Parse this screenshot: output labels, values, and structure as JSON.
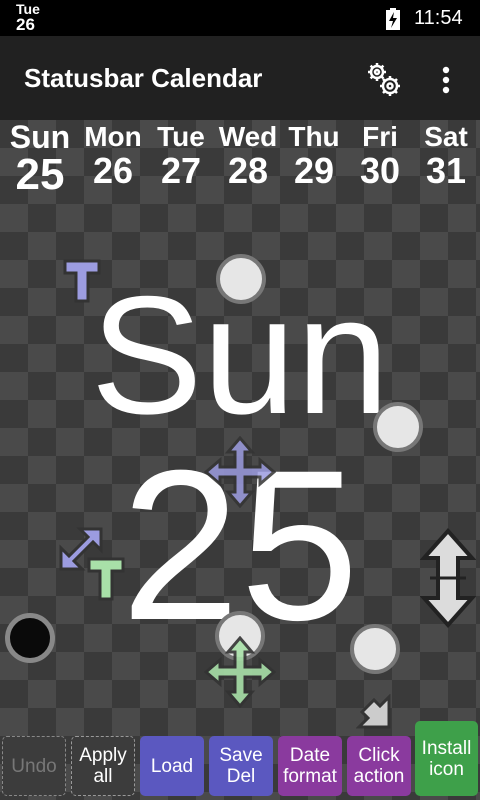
{
  "status_bar": {
    "day": "Tue",
    "date": "26",
    "time": "11:54"
  },
  "app_bar": {
    "title": "Statusbar Calendar"
  },
  "week": [
    {
      "day": "Sun",
      "date": "25"
    },
    {
      "day": "Mon",
      "date": "26"
    },
    {
      "day": "Tue",
      "date": "27"
    },
    {
      "day": "Wed",
      "date": "28"
    },
    {
      "day": "Thu",
      "date": "29"
    },
    {
      "day": "Fri",
      "date": "30"
    },
    {
      "day": "Sat",
      "date": "31"
    }
  ],
  "preview": {
    "day": "Sun",
    "date": "25"
  },
  "buttons": {
    "undo": "Undo",
    "apply_all": "Apply\nall",
    "load": "Load",
    "save_del": "Save\nDel",
    "date_format": "Date\nformat",
    "click_action": "Click\naction",
    "install_icon": "Install\nicon"
  },
  "colors": {
    "purple_handle": "#9c9ce0",
    "green_handle": "#a8e0a8",
    "white_handle": "#dcdcdc",
    "load_save": "#5b58c0",
    "date_click": "#8a3a9e",
    "install": "#3ea04a"
  }
}
